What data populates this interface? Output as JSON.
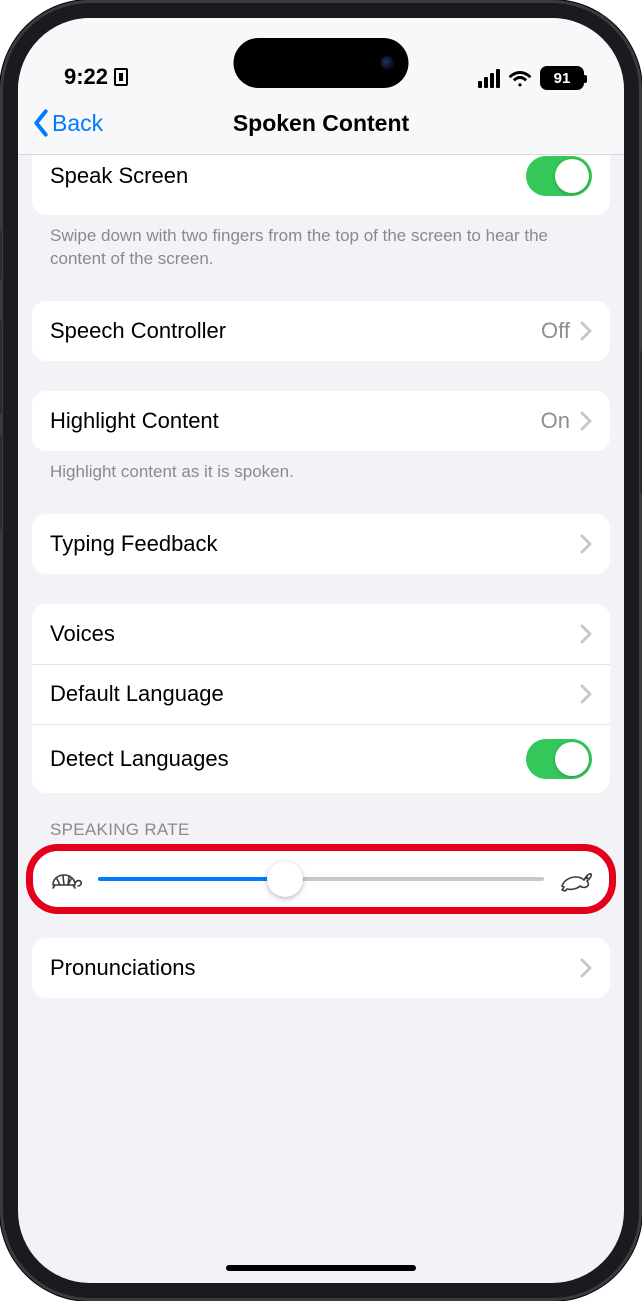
{
  "status": {
    "time": "9:22",
    "battery": "91"
  },
  "nav": {
    "back": "Back",
    "title": "Spoken Content"
  },
  "rows": {
    "speak_screen": {
      "label": "Speak Screen"
    },
    "speak_screen_footer": "Swipe down with two fingers from the top of the screen to hear the content of the screen.",
    "speech_controller": {
      "label": "Speech Controller",
      "value": "Off"
    },
    "highlight_content": {
      "label": "Highlight Content",
      "value": "On"
    },
    "highlight_content_footer": "Highlight content as it is spoken.",
    "typing_feedback": {
      "label": "Typing Feedback"
    },
    "voices": {
      "label": "Voices"
    },
    "default_language": {
      "label": "Default Language"
    },
    "detect_languages": {
      "label": "Detect Languages"
    },
    "speaking_rate_header": "Speaking Rate",
    "pronunciations": {
      "label": "Pronunciations"
    }
  },
  "slider": {
    "percent": 42
  }
}
